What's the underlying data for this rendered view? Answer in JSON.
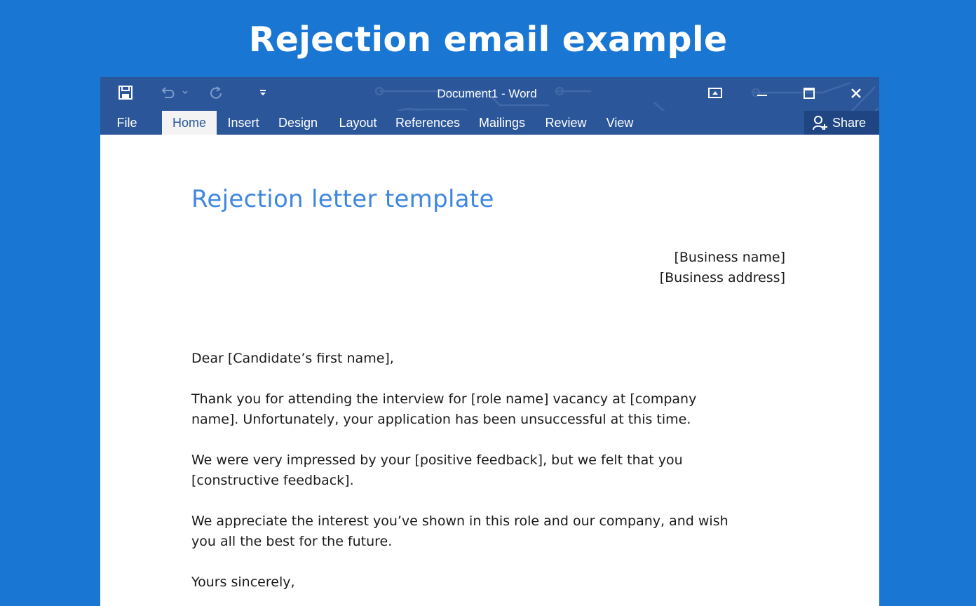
{
  "page": {
    "title": "Rejection email example"
  },
  "window": {
    "title": "Document1 - Word",
    "icons": {
      "save": "save-icon",
      "undo": "undo-icon",
      "redo": "redo-icon",
      "customize": "customize-qat-icon",
      "ribbon_display": "ribbon-display-options-icon",
      "minimize": "minimize-icon",
      "maximize": "maximize-icon",
      "close": "close-icon",
      "share": "person-add-icon"
    }
  },
  "ribbon": {
    "tabs": [
      "File",
      "Home",
      "Insert",
      "Design",
      "Layout",
      "References",
      "Mailings",
      "Review",
      "View"
    ],
    "active_tab": "Home",
    "share_label": "Share"
  },
  "document": {
    "heading": "Rejection letter template",
    "business_name": "[Business name]",
    "business_address": "[Business address]",
    "salutation": "Dear [Candidate’s first name],",
    "para1_line1": "Thank you for attending the interview for [role name] vacancy at [company",
    "para1_line2": "name]. Unfortunately, your application has been unsuccessful at this time.",
    "para2_line1": "We were very impressed by your [positive feedback], but we felt that you",
    "para2_line2": "[constructive feedback].",
    "para3_line1": "We appreciate the interest you’ve shown in this role and our company, and wish",
    "para3_line2": "you all the best for the future.",
    "closing": "Yours sincerely,"
  },
  "colors": {
    "background": "#1976d2",
    "word_blue": "#2b579a",
    "heading_blue": "#3f87e0"
  }
}
